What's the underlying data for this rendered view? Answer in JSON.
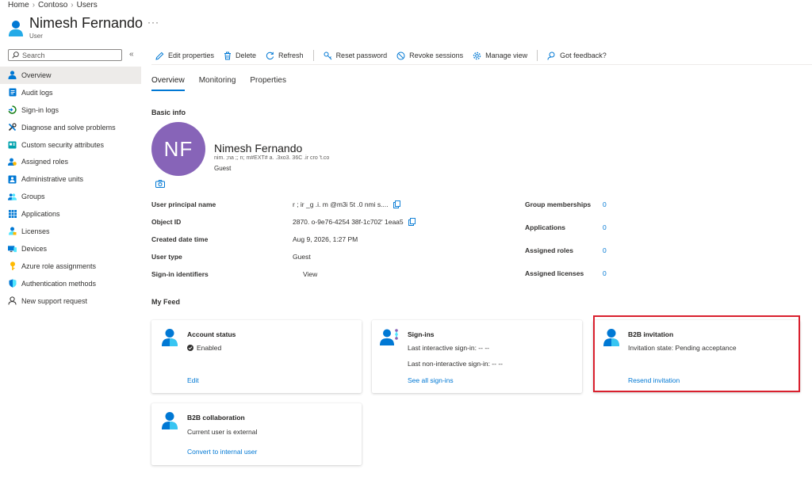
{
  "breadcrumb": [
    "Home",
    "Contoso",
    "Users"
  ],
  "header": {
    "title": "Nimesh Fernando",
    "subtitle": "User",
    "more": "···"
  },
  "search": {
    "placeholder": "Search",
    "collapse": "«"
  },
  "nav": [
    {
      "label": "Overview",
      "icon": "user-icon",
      "color": "#0078d4"
    },
    {
      "label": "Audit logs",
      "icon": "audit-log-icon",
      "color": "#0078d4"
    },
    {
      "label": "Sign-in logs",
      "icon": "sign-in-icon",
      "color": "#107c10"
    },
    {
      "label": "Diagnose and solve problems",
      "icon": "wrench-icon",
      "color": "#323130"
    },
    {
      "label": "Custom security attributes",
      "icon": "security-attributes-icon",
      "color": "#00a2ad"
    },
    {
      "label": "Assigned roles",
      "icon": "roles-icon",
      "color": "#107c10"
    },
    {
      "label": "Administrative units",
      "icon": "admin-units-icon",
      "color": "#0078d4"
    },
    {
      "label": "Groups",
      "icon": "groups-icon",
      "color": "#0078d4"
    },
    {
      "label": "Applications",
      "icon": "applications-icon",
      "color": "#0078d4"
    },
    {
      "label": "Licenses",
      "icon": "licenses-icon",
      "color": "#0078d4"
    },
    {
      "label": "Devices",
      "icon": "devices-icon",
      "color": "#0078d4"
    },
    {
      "label": "Azure role assignments",
      "icon": "key-icon",
      "color": "#ffb900"
    },
    {
      "label": "Authentication methods",
      "icon": "shield-icon",
      "color": "#0078d4"
    },
    {
      "label": "New support request",
      "icon": "support-person-icon",
      "color": "#323130"
    }
  ],
  "toolbar": {
    "edit": "Edit properties",
    "delete": "Delete",
    "refresh": "Refresh",
    "reset_password": "Reset password",
    "revoke_sessions": "Revoke sessions",
    "manage_view": "Manage view",
    "feedback": "Got feedback?"
  },
  "tabs": [
    "Overview",
    "Monitoring",
    "Properties"
  ],
  "basic_info": {
    "title": "Basic info",
    "initials": "NF",
    "name": "Nimesh Fernando",
    "mail": "nim.  ;na   ;;   n;       m#EXT#    a. .3xo3.   36C   .ir    cro     't.co",
    "user_type_short": "Guest"
  },
  "properties": [
    {
      "label": "User principal name",
      "value": "r     ;   ir   _g   .i.   m          @m3i          5t   .0    nmi     s....",
      "copy": true,
      "link": false
    },
    {
      "label": "Object ID",
      "value": "2870.   o-9e76-4254   38f-1c702'   1eaa5",
      "copy": true,
      "link": false
    },
    {
      "label": "Created date time",
      "value": "Aug 9, 2026, 1:27 PM",
      "copy": false,
      "link": false
    },
    {
      "label": "User type",
      "value": "Guest",
      "copy": false,
      "link": false
    },
    {
      "label": "Sign-in identifiers",
      "value": "View",
      "copy": false,
      "link": true
    }
  ],
  "counts": [
    {
      "label": "Group memberships",
      "value": "0"
    },
    {
      "label": "Applications",
      "value": "0"
    },
    {
      "label": "Assigned roles",
      "value": "0"
    },
    {
      "label": "Assigned licenses",
      "value": "0"
    }
  ],
  "feed": {
    "title": "My Feed",
    "account_status": {
      "title": "Account status",
      "status": "Enabled",
      "link": "Edit"
    },
    "sign_ins": {
      "title": "Sign-ins",
      "interactive": "Last interactive sign-in: -- --",
      "non_interactive": "Last non-interactive sign-in: -- --",
      "link": "See all sign-ins"
    },
    "b2b_invitation": {
      "title": "B2B invitation",
      "state": "Invitation state: Pending acceptance",
      "link": "Resend invitation"
    },
    "b2b_collaboration": {
      "title": "B2B collaboration",
      "text": "Current user is external",
      "link": "Convert to internal user"
    }
  },
  "colors": {
    "accent": "#0078d4",
    "avatar": "#8764b8",
    "highlight": "#d9202e"
  }
}
